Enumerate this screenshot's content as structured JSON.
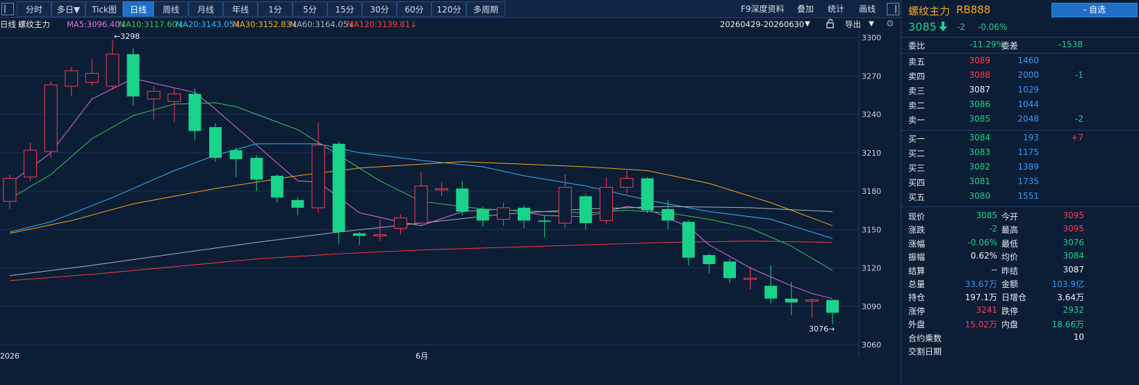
{
  "toolbar": {
    "tabs": [
      {
        "label": "分时",
        "active": false
      },
      {
        "label": "多日▼",
        "active": false
      },
      {
        "label": "Tick图",
        "active": false
      },
      {
        "label": "日线",
        "active": true
      },
      {
        "label": "周线",
        "active": false
      },
      {
        "label": "月线",
        "active": false
      },
      {
        "label": "年线",
        "active": false
      },
      {
        "label": "1分",
        "active": false
      },
      {
        "label": "5分",
        "active": false
      },
      {
        "label": "15分",
        "active": false
      },
      {
        "label": "30分",
        "active": false
      },
      {
        "label": "60分",
        "active": false
      },
      {
        "label": "120分",
        "active": false
      },
      {
        "label": "多周期",
        "active": false
      }
    ],
    "right_items": [
      "F9深度资料",
      "叠加",
      "统计",
      "画线"
    ]
  },
  "ma_row": {
    "period": "日线",
    "name": "螺纹主力",
    "items": [
      {
        "text": "MA5:3096.40↓",
        "color": "#e070e0"
      },
      {
        "text": "MA10:3117.60↓",
        "color": "#3cc35a"
      },
      {
        "text": "MA20:3143.05↓",
        "color": "#2fb6ff"
      },
      {
        "text": "MA30:3152.83↓",
        "color": "#f5a623"
      },
      {
        "text": "MA60:3164.05↓",
        "color": "#a8b3c2"
      },
      {
        "text": "MA120:3139.81↓",
        "color": "#ff3b3b"
      }
    ],
    "date_range": "20260429-20260630",
    "export": "导出",
    "date_dropdown_icon": "caret-down-icon",
    "lock_icon": "lock-icon",
    "settings_icon": "gear-icon"
  },
  "chart_data": {
    "type": "candlestick",
    "ylim": [
      3060,
      3300
    ],
    "y_ticks": [
      3300,
      3270,
      3240,
      3210,
      3180,
      3150,
      3120,
      3090,
      3060
    ],
    "x_labels": [
      "2026",
      "6月"
    ],
    "high_marker": "←3298",
    "low_marker": "3076→",
    "candles": [
      {
        "o": 3172,
        "c": 3190,
        "h": 3193,
        "l": 3166
      },
      {
        "o": 3191,
        "c": 3212,
        "h": 3218,
        "l": 3188
      },
      {
        "o": 3211,
        "c": 3263,
        "h": 3266,
        "l": 3206
      },
      {
        "o": 3262,
        "c": 3274,
        "h": 3277,
        "l": 3254
      },
      {
        "o": 3265,
        "c": 3272,
        "h": 3283,
        "l": 3262
      },
      {
        "o": 3262,
        "c": 3287,
        "h": 3298,
        "l": 3259
      },
      {
        "o": 3287,
        "c": 3254,
        "h": 3292,
        "l": 3247
      },
      {
        "o": 3252,
        "c": 3258,
        "h": 3262,
        "l": 3236
      },
      {
        "o": 3250,
        "c": 3256,
        "h": 3261,
        "l": 3234
      },
      {
        "o": 3256,
        "c": 3227,
        "h": 3260,
        "l": 3220
      },
      {
        "o": 3230,
        "c": 3206,
        "h": 3233,
        "l": 3203
      },
      {
        "o": 3212,
        "c": 3205,
        "h": 3214,
        "l": 3191
      },
      {
        "o": 3206,
        "c": 3189,
        "h": 3208,
        "l": 3180
      },
      {
        "o": 3192,
        "c": 3175,
        "h": 3193,
        "l": 3171
      },
      {
        "o": 3173,
        "c": 3167,
        "h": 3175,
        "l": 3161
      },
      {
        "o": 3167,
        "c": 3216,
        "h": 3234,
        "l": 3163
      },
      {
        "o": 3217,
        "c": 3148,
        "h": 3219,
        "l": 3139
      },
      {
        "o": 3147,
        "c": 3145,
        "h": 3148,
        "l": 3138
      },
      {
        "o": 3145,
        "c": 3146,
        "h": 3158,
        "l": 3141
      },
      {
        "o": 3151,
        "c": 3159,
        "h": 3162,
        "l": 3146
      },
      {
        "o": 3155,
        "c": 3184,
        "h": 3195,
        "l": 3153
      },
      {
        "o": 3181,
        "c": 3182,
        "h": 3187,
        "l": 3176
      },
      {
        "o": 3182,
        "c": 3164,
        "h": 3188,
        "l": 3161
      },
      {
        "o": 3166,
        "c": 3157,
        "h": 3168,
        "l": 3152
      },
      {
        "o": 3158,
        "c": 3167,
        "h": 3171,
        "l": 3153
      },
      {
        "o": 3167,
        "c": 3157,
        "h": 3169,
        "l": 3151
      },
      {
        "o": 3157,
        "c": 3156,
        "h": 3161,
        "l": 3144
      },
      {
        "o": 3155,
        "c": 3183,
        "h": 3193,
        "l": 3151
      },
      {
        "o": 3176,
        "c": 3155,
        "h": 3178,
        "l": 3150
      },
      {
        "o": 3157,
        "c": 3183,
        "h": 3191,
        "l": 3154
      },
      {
        "o": 3183,
        "c": 3190,
        "h": 3196,
        "l": 3178
      },
      {
        "o": 3190,
        "c": 3165,
        "h": 3191,
        "l": 3163
      },
      {
        "o": 3166,
        "c": 3157,
        "h": 3173,
        "l": 3150
      },
      {
        "o": 3156,
        "c": 3128,
        "h": 3157,
        "l": 3122
      },
      {
        "o": 3130,
        "c": 3123,
        "h": 3131,
        "l": 3116
      },
      {
        "o": 3125,
        "c": 3112,
        "h": 3127,
        "l": 3108
      },
      {
        "o": 3111,
        "c": 3112,
        "h": 3121,
        "l": 3103
      },
      {
        "o": 3106,
        "c": 3096,
        "h": 3122,
        "l": 3092
      },
      {
        "o": 3096,
        "c": 3093,
        "h": 3109,
        "l": 3083
      },
      {
        "o": 3094,
        "c": 3095,
        "h": 3096,
        "l": 3081
      },
      {
        "o": 3095,
        "c": 3085,
        "h": 3095,
        "l": 3076
      }
    ],
    "series": [
      {
        "name": "MA5",
        "color": "#e070e0",
        "points": [
          [
            0,
            3186
          ],
          [
            2,
            3210
          ],
          [
            4,
            3252
          ],
          [
            6,
            3268
          ],
          [
            9,
            3257
          ],
          [
            10,
            3244
          ],
          [
            14,
            3188
          ],
          [
            15,
            3187
          ],
          [
            17,
            3163
          ],
          [
            19,
            3156
          ],
          [
            20,
            3153
          ],
          [
            22,
            3164
          ],
          [
            24,
            3166
          ],
          [
            26,
            3161
          ],
          [
            28,
            3160
          ],
          [
            30,
            3168
          ],
          [
            31,
            3166
          ],
          [
            33,
            3152
          ],
          [
            34,
            3138
          ],
          [
            36,
            3120
          ],
          [
            38,
            3106
          ],
          [
            39,
            3100
          ],
          [
            40,
            3096
          ]
        ]
      },
      {
        "name": "MA10",
        "color": "#3cc35a",
        "points": [
          [
            0,
            3174
          ],
          [
            2,
            3193
          ],
          [
            4,
            3221
          ],
          [
            6,
            3239
          ],
          [
            8,
            3248
          ],
          [
            10,
            3249
          ],
          [
            11,
            3246
          ],
          [
            14,
            3228
          ],
          [
            16,
            3208
          ],
          [
            18,
            3188
          ],
          [
            20,
            3172
          ],
          [
            23,
            3166
          ],
          [
            26,
            3164
          ],
          [
            28,
            3163
          ],
          [
            30,
            3165
          ],
          [
            32,
            3163
          ],
          [
            34,
            3158
          ],
          [
            36,
            3151
          ],
          [
            38,
            3137
          ],
          [
            40,
            3118
          ]
        ]
      },
      {
        "name": "MA20",
        "color": "#2fb6ff",
        "points": [
          [
            0,
            3148
          ],
          [
            2,
            3156
          ],
          [
            5,
            3175
          ],
          [
            8,
            3196
          ],
          [
            10,
            3208
          ],
          [
            12,
            3217
          ],
          [
            15,
            3217
          ],
          [
            17,
            3210
          ],
          [
            20,
            3204
          ],
          [
            23,
            3199
          ],
          [
            25,
            3192
          ],
          [
            28,
            3184
          ],
          [
            31,
            3173
          ],
          [
            34,
            3164
          ],
          [
            37,
            3158
          ],
          [
            40,
            3143
          ]
        ]
      },
      {
        "name": "MA30",
        "color": "#f5a623",
        "points": [
          [
            0,
            3147
          ],
          [
            3,
            3157
          ],
          [
            6,
            3170
          ],
          [
            10,
            3182
          ],
          [
            14,
            3192
          ],
          [
            17,
            3198
          ],
          [
            20,
            3201
          ],
          [
            22,
            3203
          ],
          [
            25,
            3201
          ],
          [
            28,
            3199
          ],
          [
            31,
            3196
          ],
          [
            34,
            3186
          ],
          [
            37,
            3171
          ],
          [
            40,
            3153
          ]
        ]
      },
      {
        "name": "MA60",
        "color": "#a8b3c2",
        "points": [
          [
            0,
            3114
          ],
          [
            4,
            3122
          ],
          [
            8,
            3131
          ],
          [
            12,
            3140
          ],
          [
            16,
            3148
          ],
          [
            20,
            3155
          ],
          [
            24,
            3162
          ],
          [
            28,
            3166
          ],
          [
            32,
            3168
          ],
          [
            36,
            3167
          ],
          [
            40,
            3164
          ]
        ]
      },
      {
        "name": "MA120",
        "color": "#ff3b3b",
        "points": [
          [
            0,
            3110
          ],
          [
            4,
            3115
          ],
          [
            8,
            3121
          ],
          [
            12,
            3127
          ],
          [
            16,
            3131
          ],
          [
            20,
            3134
          ],
          [
            24,
            3136
          ],
          [
            28,
            3138
          ],
          [
            32,
            3140
          ],
          [
            36,
            3141
          ],
          [
            40,
            3140
          ]
        ]
      }
    ]
  },
  "panel": {
    "name": "螺纹主力",
    "code": "RB888",
    "watch_button": "- 自选",
    "price": "3085",
    "change": "-2",
    "change_pct": "-0.06%",
    "ratio": {
      "label": "委比",
      "value": "-11.29%",
      "label2": "委差",
      "value2": "-1538"
    },
    "asks": [
      {
        "label": "卖五",
        "price": "3089",
        "vol": "1460",
        "delta": "",
        "price_color": "red"
      },
      {
        "label": "卖四",
        "price": "3088",
        "vol": "2000",
        "delta": "-1",
        "price_color": "red"
      },
      {
        "label": "卖三",
        "price": "3087",
        "vol": "1029",
        "delta": "",
        "price_color": "white"
      },
      {
        "label": "卖二",
        "price": "3086",
        "vol": "1044",
        "delta": "",
        "price_color": "green"
      },
      {
        "label": "卖一",
        "price": "3085",
        "vol": "2048",
        "delta": "-2",
        "price_color": "green"
      }
    ],
    "bids": [
      {
        "label": "买一",
        "price": "3084",
        "vol": "193",
        "delta": "+7",
        "price_color": "green"
      },
      {
        "label": "买二",
        "price": "3083",
        "vol": "1175",
        "delta": "",
        "price_color": "green"
      },
      {
        "label": "买三",
        "price": "3082",
        "vol": "1389",
        "delta": "",
        "price_color": "green"
      },
      {
        "label": "买四",
        "price": "3081",
        "vol": "1735",
        "delta": "",
        "price_color": "green"
      },
      {
        "label": "买五",
        "price": "3080",
        "vol": "1551",
        "delta": "",
        "price_color": "green"
      }
    ],
    "stats": [
      {
        "l1": "现价",
        "v1": "3085",
        "c1": "green",
        "l2": "今开",
        "v2": "3095",
        "c2": "red"
      },
      {
        "l1": "涨跌",
        "v1": "-2",
        "c1": "green",
        "l2": "最高",
        "v2": "3095",
        "c2": "red"
      },
      {
        "l1": "涨幅",
        "v1": "-0.06%",
        "c1": "green",
        "l2": "最低",
        "v2": "3076",
        "c2": "green"
      },
      {
        "l1": "振幅",
        "v1": "0.62%",
        "c1": "white",
        "l2": "均价",
        "v2": "3084",
        "c2": "green"
      },
      {
        "l1": "结算",
        "v1": "--",
        "c1": "white",
        "l2": "昨结",
        "v2": "3087",
        "c2": "white"
      },
      {
        "l1": "总量",
        "v1": "33.67万",
        "c1": "blue",
        "l2": "金额",
        "v2": "103.9亿",
        "c2": "blue"
      },
      {
        "l1": "持仓",
        "v1": "197.1万",
        "c1": "white",
        "l2": "日增仓",
        "v2": "3.64万",
        "c2": "white"
      },
      {
        "l1": "涨停",
        "v1": "3241",
        "c1": "red",
        "l2": "跌停",
        "v2": "2932",
        "c2": "green"
      },
      {
        "l1": "外盘",
        "v1": "15.02万",
        "c1": "red",
        "l2": "内盘",
        "v2": "18.66万",
        "c2": "green"
      }
    ],
    "multiplier_label": "合约乘数",
    "multiplier_value": "10",
    "delivery_label": "交割日期",
    "down_arrow_icon": "down-arrow-icon"
  }
}
